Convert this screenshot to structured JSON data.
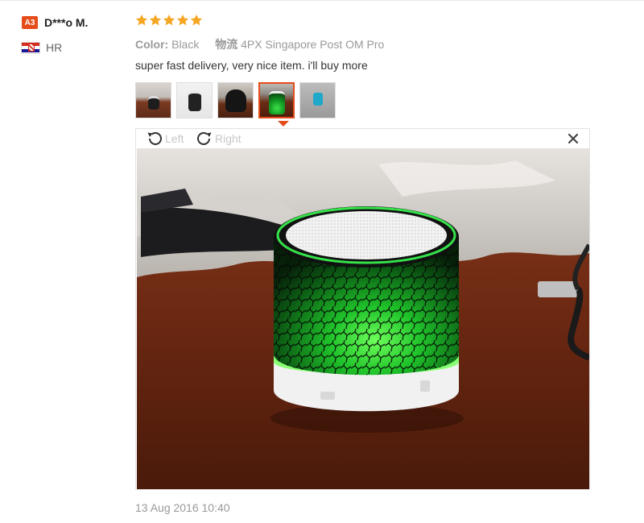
{
  "user": {
    "level_badge": "A3",
    "name": "D***o M.",
    "country_code": "HR"
  },
  "review": {
    "rating": 5,
    "color_label": "Color:",
    "color_value": "Black",
    "logistics_label": "物流",
    "logistics_value": "4PX Singapore Post OM Pro",
    "text": "super fast delivery, very nice item. i'll buy more",
    "date": "13 Aug 2016 10:40"
  },
  "viewer": {
    "rotate_left_label": "Left",
    "rotate_right_label": "Right",
    "close_label": "×"
  },
  "colors": {
    "accent": "#e54c1a",
    "star": "#f5a623",
    "muted_text": "#999999"
  }
}
